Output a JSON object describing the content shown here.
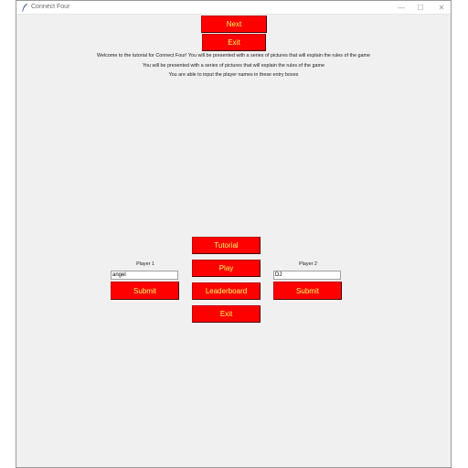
{
  "window": {
    "title": "Connect Four",
    "controls": {
      "minimize": "—",
      "maximize": "☐",
      "close": "✕"
    }
  },
  "tutorial": {
    "next_label": "Next",
    "exit_label": "Exit",
    "lines": [
      "Welcome to the tutorial for Connect Four! You will be presented with a series of pictures that will explain the rules of the game",
      "You will be presented with a series of pictures that will explain the rules of the game",
      "You are able to input the player names in these entry boxes"
    ]
  },
  "menu": {
    "tutorial_label": "Tutorial",
    "play_label": "Play",
    "leaderboard_label": "Leaderboard",
    "exit_label": "Exit"
  },
  "player1": {
    "label": "Player 1",
    "value": "angel",
    "submit_label": "Submit"
  },
  "player2": {
    "label": "Player 2",
    "value": "DJ",
    "submit_label": "Submit"
  },
  "colors": {
    "button_bg": "#ff0000",
    "button_text": "#ffff66",
    "window_bg": "#f0f0f0"
  }
}
